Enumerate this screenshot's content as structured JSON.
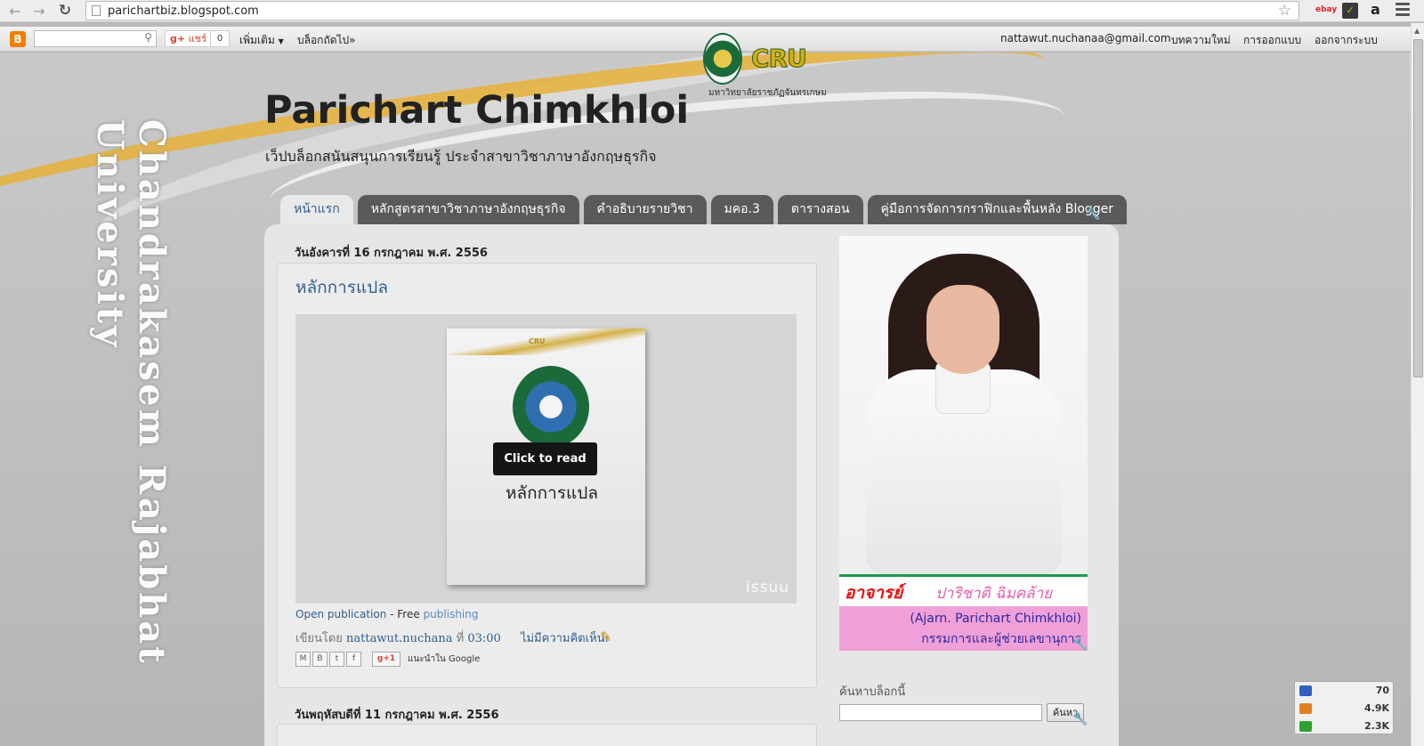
{
  "browser": {
    "url": "parichartbiz.blogspot.com",
    "ext_ebay": "ebay",
    "ext_amazon": "a"
  },
  "navbar": {
    "share_label": "แชร์",
    "share_count": "0",
    "more_label": "เพิ่มเติม",
    "next_blog_label": "บล็อกถัดไป»",
    "user_email": "nattawut.nuchanaa@gmail.com",
    "new_post": "บทความใหม่",
    "design": "การออกแบบ",
    "sign_out": "ออกจากระบบ"
  },
  "background": {
    "vertical_text": "Chandrakasem Rajabhat University"
  },
  "header": {
    "logo_text": "CRU",
    "logo_subtitle": "มหาวิทยาลัยราชภัฏจันทรเกษม",
    "title": "Parichart Chimkhloi",
    "description": "เว็ปบล็อกสนันสนุนการเรียนรู้ ประจำสาขาวิชาภาษาอังกฤษธุรกิจ"
  },
  "tabs": [
    {
      "label": "หน้าแรก"
    },
    {
      "label": "หลักสูตรสาขาวิชาภาษาอังกฤษธุรกิจ"
    },
    {
      "label": "คำอธิบายรายวิชา"
    },
    {
      "label": "มคอ.3"
    },
    {
      "label": "ตารางสอน"
    },
    {
      "label": "คู่มือการจัดการกราฟิกและพื้นหลัง Blogger"
    }
  ],
  "post": {
    "date": "วันอังคารที่ 16 กรกฎาคม พ.ศ. 2556",
    "title": "หลักการแปล",
    "embed": {
      "click_to_read": "Click to read",
      "book_title": "หลักการแปล",
      "issuu_logo": "issuu"
    },
    "open_publication": "Open publication",
    "free_text": " - Free ",
    "publishing": "publishing",
    "posted_by": "เขียนโดย",
    "author": "nattawut.nuchana",
    "at": "ที่",
    "time": "03:00",
    "comments": "ไม่มีความคิดเห็น:",
    "recommend": "แนะนำใน Google",
    "gplus_label": "+1"
  },
  "post2": {
    "date": "วันพฤหัสบดีที่ 11 กรกฎาคม พ.ศ. 2556"
  },
  "sidebar": {
    "profile": {
      "prefix": "อาจารย์",
      "name_thai": "ปาริชาติ  ฉิมคล้าย",
      "name_en": "(Ajarn. Parichart  Chimkhloi)",
      "role": "กรรมการและผู้ช่วยเลขานุการ"
    },
    "search_title": "ค้นหาบล็อกนี้",
    "search_button": "ค้นหา"
  },
  "tray": [
    {
      "value": "70",
      "color": "#3060c0"
    },
    {
      "value": "4.9K",
      "color": "#e08020"
    },
    {
      "value": "2.3K",
      "color": "#30a030"
    }
  ]
}
